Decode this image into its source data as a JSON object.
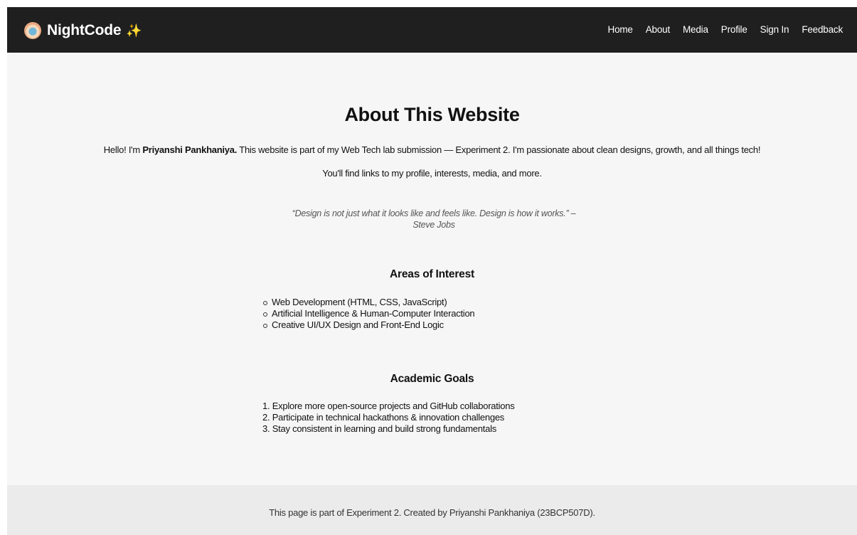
{
  "navbar": {
    "brand": "NightCode",
    "brand_icon": "nightcode-logo-icon",
    "sparkle": "✨",
    "links": [
      "Home",
      "About",
      "Media",
      "Profile",
      "Sign In",
      "Feedback"
    ]
  },
  "main": {
    "title": "About This Website",
    "intro_prefix": "Hello! I'm ",
    "intro_name": "Priyanshi Pankhaniya.",
    "intro_suffix": " This website is part of my Web Tech lab submission — Experiment 2. I'm passionate about clean designs, growth, and all things tech!",
    "intro_line2": "You'll find links to my profile, interests, media, and more.",
    "quote": "“Design is not just what it looks like and feels like. Design is how it works.” – Steve Jobs",
    "interests_heading": "Areas of Interest",
    "interests": [
      "Web Development (HTML, CSS, JavaScript)",
      "Artificial Intelligence & Human-Computer Interaction",
      "Creative UI/UX Design and Front-End Logic"
    ],
    "goals_heading": "Academic Goals",
    "goals": [
      "1. Explore more open-source projects and GitHub collaborations",
      "2. Participate in technical hackathons & innovation challenges",
      "3. Stay consistent in learning and build strong fundamentals"
    ]
  },
  "footer": {
    "text": "This page is part of Experiment 2. Created by Priyanshi Pankhaniya (23BCP507D)."
  },
  "colors": {
    "navbar_bg": "#1f1f1f",
    "page_bg": "#f6f6f6",
    "footer_bg": "#ebebeb",
    "sparkle": "#ffb238"
  }
}
